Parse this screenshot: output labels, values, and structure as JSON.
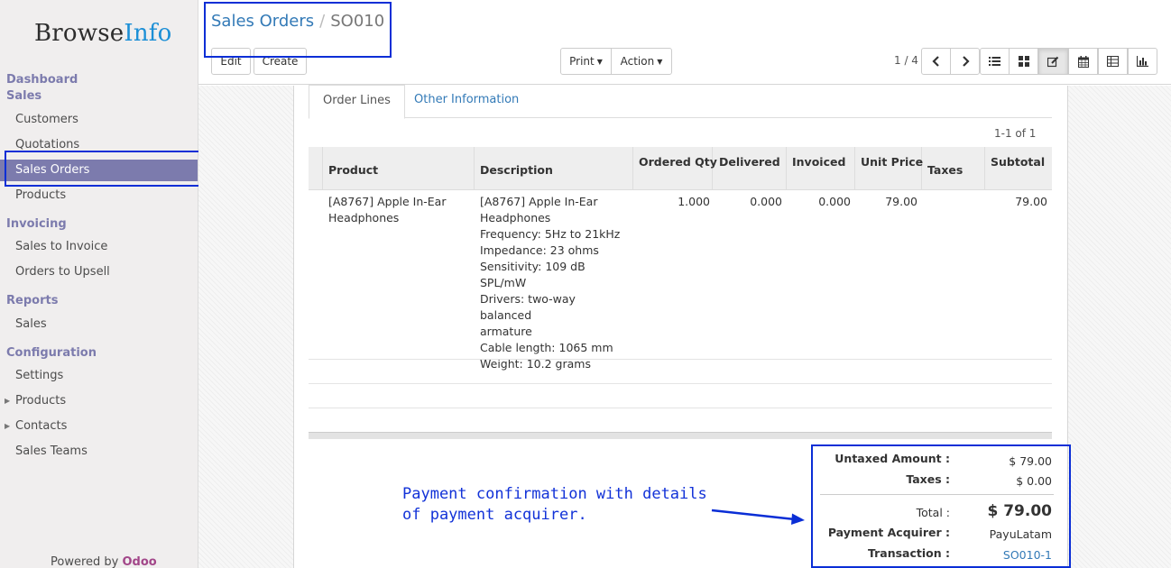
{
  "sidebar": {
    "logo": {
      "part1": "Browse",
      "part2": "Info"
    },
    "sections": [
      {
        "label": "Dashboard"
      },
      {
        "label": "Sales"
      },
      {
        "label": "Invoicing"
      },
      {
        "label": "Reports"
      },
      {
        "label": "Configuration"
      }
    ],
    "items": {
      "customers": "Customers",
      "quotations": "Quotations",
      "sales_orders": "Sales Orders",
      "products": "Products",
      "sales_to_invoice": "Sales to Invoice",
      "orders_to_upsell": "Orders to Upsell",
      "reports_sales": "Sales",
      "settings": "Settings",
      "config_products": "Products",
      "contacts": "Contacts",
      "sales_teams": "Sales Teams"
    },
    "powered_by": "Powered by",
    "powered_brand": "Odoo"
  },
  "control": {
    "breadcrumb_parent": "Sales Orders",
    "breadcrumb_sep": "/",
    "breadcrumb_current": "SO010",
    "edit_label": "Edit",
    "create_label": "Create",
    "print_label": "Print",
    "action_label": "Action",
    "pager": "1 / 4",
    "icons": [
      "chevron-left-icon",
      "chevron-right-icon",
      "list-view-icon",
      "kanban-view-icon",
      "form-view-icon",
      "calendar-view-icon",
      "pivot-view-icon",
      "graph-view-icon"
    ]
  },
  "tabs": {
    "order_lines": "Order Lines",
    "other_info": "Other Information"
  },
  "table": {
    "record_count": "1-1 of 1",
    "headers": {
      "product": "Product",
      "description": "Description",
      "ordered_qty": "Ordered Qty",
      "delivered": "Delivered",
      "invoiced": "Invoiced",
      "unit_price": "Unit Price",
      "taxes": "Taxes",
      "subtotal": "Subtotal"
    },
    "rows": [
      {
        "product": [
          "[A8767] Apple In-Ear",
          "Headphones"
        ],
        "description": [
          "[A8767] Apple In-Ear",
          "Headphones",
          "Frequency: 5Hz to 21kHz",
          "Impedance: 23 ohms",
          "Sensitivity: 109 dB",
          "SPL/mW",
          "Drivers: two-way balanced",
          "armature",
          "Cable length: 1065 mm",
          "Weight: 10.2 grams"
        ],
        "ordered_qty": "1.000",
        "delivered": "0.000",
        "invoiced": "0.000",
        "unit_price": "79.00",
        "taxes": "",
        "subtotal": "79.00"
      }
    ]
  },
  "totals": {
    "untaxed_label": "Untaxed Amount :",
    "untaxed_value": "$ 79.00",
    "taxes_label": "Taxes :",
    "taxes_value": "$ 0.00",
    "total_label": "Total :",
    "total_value": "$ 79.00",
    "acquirer_label": "Payment Acquirer :",
    "acquirer_value": "PayuLatam",
    "transaction_label": "Transaction :",
    "transaction_value": "SO010-1"
  },
  "annotation": {
    "line1": "Payment confirmation with details",
    "line2": "of payment acquirer."
  },
  "colors": {
    "accent": "#7c7bad",
    "link": "#337ab7",
    "annotation": "#0a2ed6",
    "brand": "#a24689"
  }
}
